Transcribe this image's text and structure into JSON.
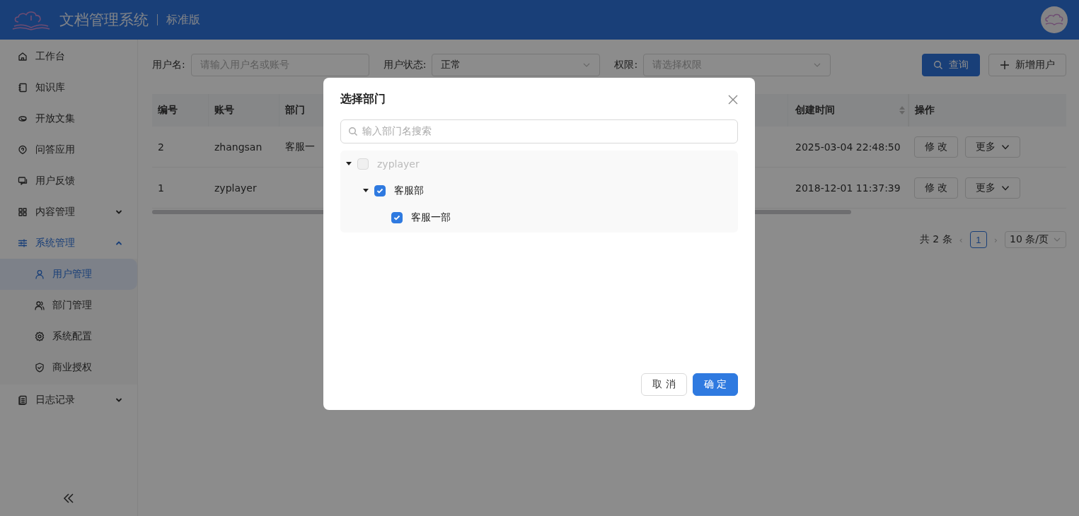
{
  "header": {
    "title": "文档管理系统",
    "edition": "标准版"
  },
  "sidebar": {
    "items": [
      {
        "label": "工作台",
        "kind": "link",
        "selected": false
      },
      {
        "label": "知识库",
        "kind": "link",
        "selected": false
      },
      {
        "label": "开放文集",
        "kind": "link",
        "selected": false
      },
      {
        "label": "问答应用",
        "kind": "link",
        "selected": false
      },
      {
        "label": "用户反馈",
        "kind": "link",
        "selected": false
      },
      {
        "label": "内容管理",
        "kind": "group",
        "expanded": false,
        "selected": false
      },
      {
        "label": "系统管理",
        "kind": "group",
        "expanded": true,
        "selected": true,
        "children": [
          {
            "label": "用户管理",
            "selected": true
          },
          {
            "label": "部门管理",
            "selected": false
          },
          {
            "label": "系统配置",
            "selected": false
          },
          {
            "label": "商业授权",
            "selected": false
          }
        ]
      },
      {
        "label": "日志记录",
        "kind": "group",
        "expanded": false,
        "selected": false
      }
    ]
  },
  "filters": [
    {
      "label": "用户名:",
      "kind": "input",
      "placeholder": "请输入用户名或账号"
    },
    {
      "label": "用户状态:",
      "kind": "select",
      "value": "正常"
    },
    {
      "label": "权限:",
      "kind": "select",
      "placeholder": "请选择权限"
    }
  ],
  "actions": [
    {
      "label": "查询",
      "kind": "primary"
    },
    {
      "label": "新增用户",
      "kind": "default"
    }
  ],
  "table": {
    "columns": [
      {
        "label": "编号"
      },
      {
        "label": "账号"
      },
      {
        "label": "部门"
      },
      {
        "label": "创建时间",
        "sortable": true
      },
      {
        "label": "操作"
      }
    ],
    "rows": [
      {
        "id": "2",
        "account": "zhangsan",
        "department": "客服一",
        "created": "2025-03-04 22:48:50",
        "actions": [
          "修 改",
          "更多"
        ]
      },
      {
        "id": "1",
        "account": "zyplayer",
        "created": "2018-12-01 11:37:39",
        "actions": [
          "修 改",
          "更多"
        ]
      }
    ]
  },
  "pagination": {
    "total": "共 2 条",
    "prev": "‹",
    "next": "›",
    "pages": [
      {
        "label": "1",
        "selected": true
      }
    ],
    "page_size": "10 条/页"
  },
  "modal": {
    "title": "选择部门",
    "search_placeholder": "输入部门名搜索",
    "tree": [
      {
        "label": "zyplayer",
        "checked": false,
        "disabled": true,
        "expanded": true,
        "children": [
          {
            "label": "客服部",
            "checked": true,
            "disabled": false,
            "expanded": true,
            "children": [
              {
                "label": "客服一部",
                "checked": true,
                "disabled": false,
                "expanded": false
              }
            ]
          }
        ]
      }
    ],
    "buttons": [
      {
        "label": "取 消",
        "kind": "default"
      },
      {
        "label": "确 定",
        "kind": "primary"
      }
    ]
  }
}
